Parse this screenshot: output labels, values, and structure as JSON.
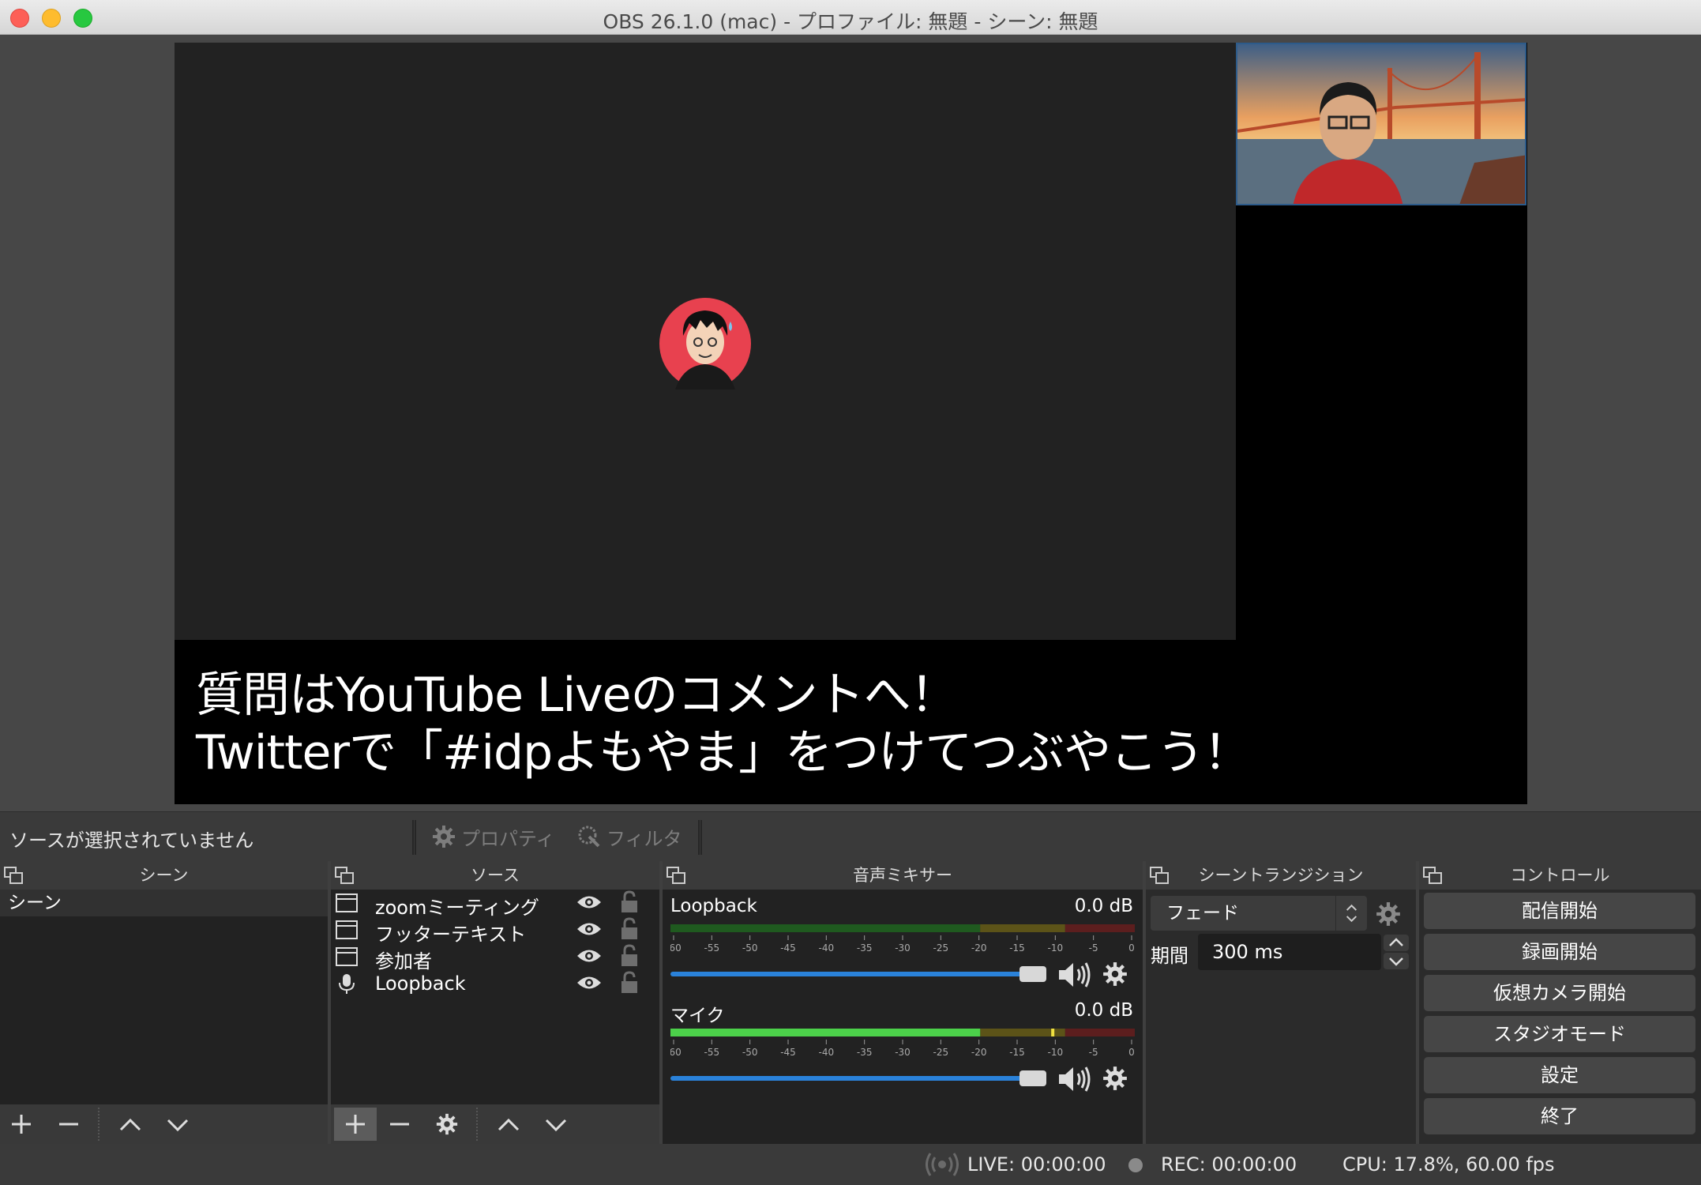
{
  "window": {
    "title": "OBS 26.1.0 (mac) - プロファイル: 無題 - シーン: 無題"
  },
  "preview": {
    "caption_line1": "質問はYouTube Liveのコメントへ！",
    "caption_line2": "Twitterで「#idpよもやま」をつけてつぶやこう！"
  },
  "source_toolbar": {
    "status": "ソースが選択されていません",
    "properties_label": "プロパティ",
    "filters_label": "フィルタ"
  },
  "docks": {
    "scenes": {
      "title": "シーン",
      "items": [
        "シーン"
      ]
    },
    "sources": {
      "title": "ソース",
      "items": [
        {
          "name": "zoomミーティング",
          "icon": "window-capture-icon"
        },
        {
          "name": "フッターテキスト",
          "icon": "window-capture-icon"
        },
        {
          "name": "参加者",
          "icon": "window-capture-icon"
        },
        {
          "name": "Loopback",
          "icon": "microphone-icon"
        }
      ]
    },
    "mixer": {
      "title": "音声ミキサー",
      "channels": [
        {
          "name": "Loopback",
          "db": "0.0 dB",
          "level": 0.0
        },
        {
          "name": "マイク",
          "db": "0.0 dB",
          "level": 0.82
        }
      ],
      "scale": [
        "-60",
        "-55",
        "-50",
        "-45",
        "-40",
        "-35",
        "-30",
        "-25",
        "-20",
        "-15",
        "-10",
        "-5",
        "0"
      ]
    },
    "transitions": {
      "title": "シーントランジション",
      "selected": "フェード",
      "duration_label": "期間",
      "duration_value": "300 ms"
    },
    "controls": {
      "title": "コントロール",
      "buttons": [
        "配信開始",
        "録画開始",
        "仮想カメラ開始",
        "スタジオモード",
        "設定",
        "終了"
      ]
    }
  },
  "status_bar": {
    "live": "LIVE: 00:00:00",
    "rec": "REC: 00:00:00",
    "cpu": "CPU: 17.8%, 60.00 fps"
  },
  "colors": {
    "accent": "#2a82da",
    "meter_green": "#4cd14a",
    "meter_yellow": "#c8b42a",
    "meter_red": "#d23a3a"
  }
}
